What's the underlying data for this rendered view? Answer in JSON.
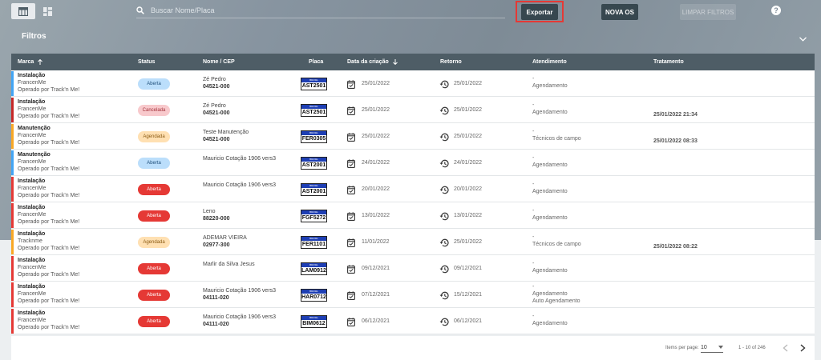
{
  "toolbar": {
    "search_placeholder": "Buscar Nome/Placa",
    "export_label": "Exportar",
    "nova_os_label": "NOVA OS",
    "limpar_label": "LIMPAR FILTROS",
    "help_label": "?",
    "icons": [
      "table-view-icon",
      "grid-view-icon",
      "search-icon",
      "help-icon"
    ]
  },
  "filters": {
    "label": "Filtros"
  },
  "table": {
    "headers": {
      "marca": "Marca",
      "status": "Status",
      "nome": "Nome / CEP",
      "placa": "Placa",
      "data": "Data da criação",
      "retorno": "Retorno",
      "atendimento": "Atendimento",
      "tratamento": "Tratamento"
    },
    "plate_country": "BRASIL",
    "rows": [
      {
        "type": "Instalação",
        "brand": "FrancenMe",
        "operator": "Operado por Track'n Me!",
        "status": "Aberta",
        "status_kind": "open-blue",
        "bar_color": "#42a5f5",
        "name": "Zé Pedro",
        "cep": "04521-000",
        "plate": "AST2501",
        "created": "25/01/2022",
        "retorno": "25/01/2022",
        "atend1": "-",
        "atend2": "Agendamento",
        "atend3": "",
        "trat": ""
      },
      {
        "type": "Instalação",
        "brand": "FrancenMe",
        "operator": "Operado por Track'n Me!",
        "status": "Cancelada",
        "status_kind": "cancel",
        "bar_color": "#c62828",
        "name": "Zé Pedro",
        "cep": "04521-000",
        "plate": "AST2501",
        "created": "25/01/2022",
        "retorno": "25/01/2022",
        "atend1": "-",
        "atend2": "Agendamento",
        "atend3": "",
        "trat": "25/01/2022 21:34"
      },
      {
        "type": "Manutenção",
        "brand": "FrancenMe",
        "operator": "Operado por Track'n Me!",
        "status": "Agendada",
        "status_kind": "scheduled",
        "bar_color": "#f9a825",
        "name": "Teste Manutenção",
        "cep": "04521-000",
        "plate": "FER0305",
        "created": "25/01/2022",
        "retorno": "25/01/2022",
        "atend1": "-",
        "atend2": "Técnicos de campo",
        "atend3": "",
        "trat": "25/01/2022 08:33"
      },
      {
        "type": "Manutenção",
        "brand": "FrancenMe",
        "operator": "Operado por Track'n Me!",
        "status": "Aberta",
        "status_kind": "open-blue",
        "bar_color": "#42a5f5",
        "name": "Mauricio Cotação 1906 vers3",
        "cep": "",
        "plate": "AST2001",
        "created": "24/01/2022",
        "retorno": "24/01/2022",
        "atend1": "-",
        "atend2": "Agendamento",
        "atend3": "",
        "trat": ""
      },
      {
        "type": "Instalação",
        "brand": "FrancenMe",
        "operator": "Operado por Track'n Me!",
        "status": "Aberta",
        "status_kind": "open-red",
        "bar_color": "#e53935",
        "name": "Mauricio Cotação 1906 vers3",
        "cep": "",
        "plate": "AST2001",
        "created": "20/01/2022",
        "retorno": "20/01/2022",
        "atend1": "-",
        "atend2": "Agendamento",
        "atend3": "",
        "trat": ""
      },
      {
        "type": "Instalação",
        "brand": "FrancenMe",
        "operator": "Operado por Track'n Me!",
        "status": "Aberta",
        "status_kind": "open-red",
        "bar_color": "#e53935",
        "name": "Leno",
        "cep": "88220-000",
        "plate": "FGF5272",
        "created": "13/01/2022",
        "retorno": "13/01/2022",
        "atend1": "-",
        "atend2": "Agendamento",
        "atend3": "",
        "trat": ""
      },
      {
        "type": "Instalação",
        "brand": "Tracknme",
        "operator": "Operado por Track'n Me!",
        "status": "Agendada",
        "status_kind": "scheduled",
        "bar_color": "#f9a825",
        "name": "ADEMAR VIEIRA",
        "cep": "02977-300",
        "plate": "FER1101",
        "created": "11/01/2022",
        "retorno": "25/01/2022",
        "atend1": "-",
        "atend2": "Técnicos de campo",
        "atend3": "",
        "trat": "25/01/2022 08:22"
      },
      {
        "type": "Instalação",
        "brand": "FrancenMe",
        "operator": "Operado por Track'n Me!",
        "status": "Aberta",
        "status_kind": "open-red",
        "bar_color": "#e53935",
        "name": "Marlir da Silva Jesus",
        "cep": "",
        "plate": "LAM0912",
        "created": "09/12/2021",
        "retorno": "09/12/2021",
        "atend1": "-",
        "atend2": "Agendamento",
        "atend3": "",
        "trat": ""
      },
      {
        "type": "Instalação",
        "brand": "FrancenMe",
        "operator": "Operado por Track'n Me!",
        "status": "Aberta",
        "status_kind": "open-red",
        "bar_color": "#e53935",
        "name": "Mauricio Cotação 1906 vers3",
        "cep": "04111-020",
        "plate": "HAR0712",
        "created": "07/12/2021",
        "retorno": "15/12/2021",
        "atend1": "-",
        "atend2": "Agendamento",
        "atend3": "Auto Agendamento",
        "trat": ""
      },
      {
        "type": "Instalação",
        "brand": "FrancenMe",
        "operator": "Operado por Track'n Me!",
        "status": "Aberta",
        "status_kind": "open-red",
        "bar_color": "#e53935",
        "name": "Mauricio Cotação 1906 vers3",
        "cep": "04111-020",
        "plate": "BIM0612",
        "created": "06/12/2021",
        "retorno": "06/12/2021",
        "atend1": "-",
        "atend2": "Agendamento",
        "atend3": "",
        "trat": ""
      }
    ]
  },
  "pagination": {
    "items_per_page_label": "Items per page:",
    "items_per_page_value": "10",
    "range_label": "1 - 10 of 246"
  },
  "colors": {
    "header_dark": "#4e5d66",
    "button_dark": "#37474f",
    "highlight_red": "#e53935",
    "status_open_blue_bg": "#bbdefb",
    "status_cancel_bg": "#f8c9cc",
    "status_scheduled_bg": "#ffe0b2",
    "status_open_red_bg": "#e53935"
  }
}
